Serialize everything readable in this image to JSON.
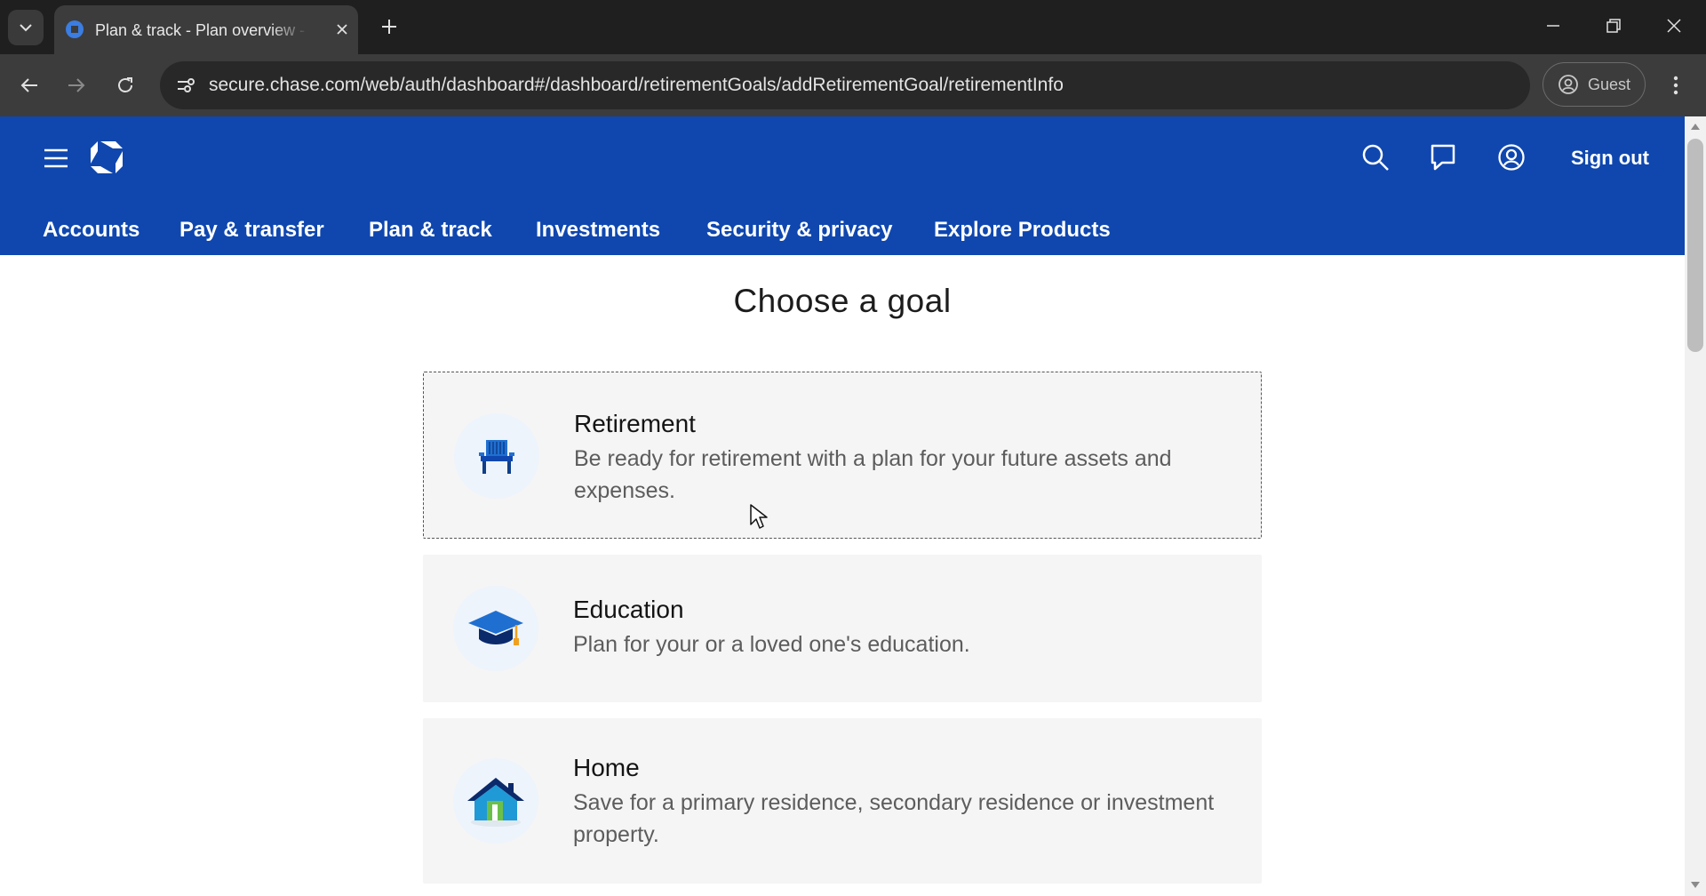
{
  "browser": {
    "tab_title": "Plan & track - Plan overview - c",
    "url": "secure.chase.com/web/auth/dashboard#/dashboard/retirementGoals/addRetirementGoal/retirementInfo",
    "profile_label": "Guest",
    "icons": [
      "tab-search-icon",
      "chase-favicon",
      "close-icon",
      "plus-icon",
      "minimize-icon",
      "restore-icon",
      "close-window-icon",
      "back-arrow-icon",
      "forward-arrow-icon",
      "reload-icon",
      "site-settings-icon",
      "profile-icon",
      "kebab-menu-icon"
    ]
  },
  "header": {
    "sign_out": "Sign out",
    "icons": [
      "hamburger-menu-icon",
      "chase-logo",
      "search-icon",
      "messages-icon",
      "account-icon"
    ],
    "brand_color": "#0f47af"
  },
  "nav": {
    "items": [
      {
        "label": "Accounts"
      },
      {
        "label": "Pay & transfer"
      },
      {
        "label": "Plan & track"
      },
      {
        "label": "Investments"
      },
      {
        "label": "Security & privacy"
      },
      {
        "label": "Explore Products"
      }
    ]
  },
  "main": {
    "title": "Choose a goal",
    "goals": [
      {
        "title": "Retirement",
        "description": "Be ready for retirement with a plan for your future assets and expenses.",
        "icon": "beach-chair-icon"
      },
      {
        "title": "Education",
        "description": "Plan for your or a loved one's education.",
        "icon": "graduation-cap-icon"
      },
      {
        "title": "Home",
        "description": "Save for a primary residence, secondary residence or investment property.",
        "icon": "house-icon"
      }
    ]
  }
}
